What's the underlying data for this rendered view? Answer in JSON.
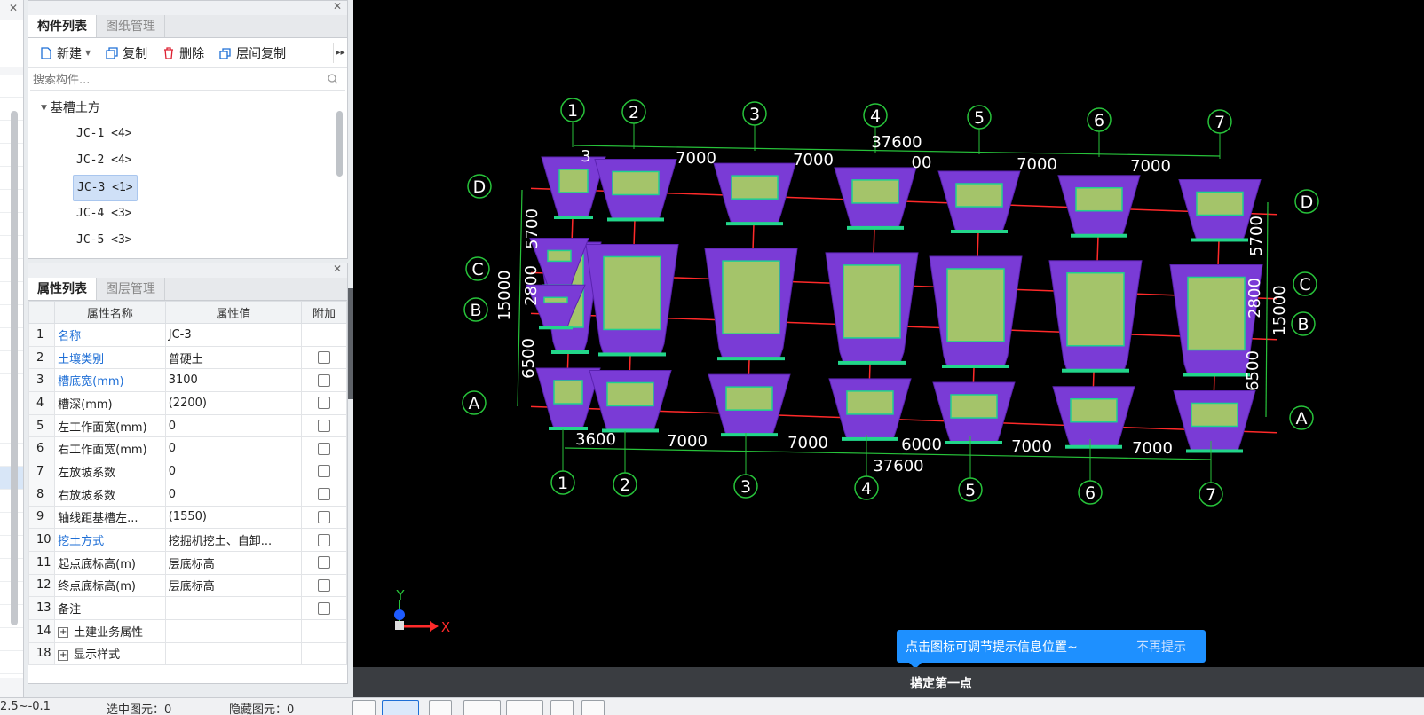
{
  "component_panel": {
    "tabs": [
      "构件列表",
      "图纸管理"
    ],
    "toolbar": {
      "new": "新建",
      "copy": "复制",
      "delete": "删除",
      "floor_copy": "层间复制"
    },
    "search_placeholder": "搜索构件...",
    "tree": {
      "root": "基槽土方",
      "items": [
        "JC-1 <4>",
        "JC-2 <4>",
        "JC-3 <1>",
        "JC-4 <3>",
        "JC-5 <3>"
      ],
      "selected_index": 2
    }
  },
  "property_panel": {
    "tabs": [
      "属性列表",
      "图层管理"
    ],
    "columns": [
      "属性名称",
      "属性值",
      "附加"
    ],
    "rows": [
      {
        "idx": "1",
        "name": "名称",
        "value": "JC-3",
        "blue": true,
        "checkbox": false
      },
      {
        "idx": "2",
        "name": "土壤类别",
        "value": "普硬土",
        "blue": true,
        "checkbox": true
      },
      {
        "idx": "3",
        "name": "槽底宽(mm)",
        "value": "3100",
        "blue": true,
        "checkbox": true
      },
      {
        "idx": "4",
        "name": "槽深(mm)",
        "value": "(2200)",
        "blue": false,
        "checkbox": true
      },
      {
        "idx": "5",
        "name": "左工作面宽(mm)",
        "value": "0",
        "blue": false,
        "checkbox": true
      },
      {
        "idx": "6",
        "name": "右工作面宽(mm)",
        "value": "0",
        "blue": false,
        "checkbox": true
      },
      {
        "idx": "7",
        "name": "左放坡系数",
        "value": "0",
        "blue": false,
        "checkbox": true
      },
      {
        "idx": "8",
        "name": "右放坡系数",
        "value": "0",
        "blue": false,
        "checkbox": true
      },
      {
        "idx": "9",
        "name": "轴线距基槽左...",
        "value": "(1550)",
        "blue": false,
        "checkbox": true
      },
      {
        "idx": "10",
        "name": "挖土方式",
        "value": "挖掘机挖土、自卸...",
        "blue": true,
        "checkbox": true
      },
      {
        "idx": "11",
        "name": "起点底标高(m)",
        "value": "层底标高",
        "blue": false,
        "checkbox": true
      },
      {
        "idx": "12",
        "name": "终点底标高(m)",
        "value": "层底标高",
        "blue": false,
        "checkbox": true
      },
      {
        "idx": "13",
        "name": "备注",
        "value": "",
        "blue": false,
        "checkbox": true
      },
      {
        "idx": "14",
        "name": "土建业务属性",
        "value": "",
        "blue": false,
        "checkbox": false,
        "expand": true
      },
      {
        "idx": "18",
        "name": "显示样式",
        "value": "",
        "blue": false,
        "checkbox": false,
        "expand": true
      }
    ]
  },
  "viewport": {
    "axis_numbers": [
      "1",
      "2",
      "3",
      "4",
      "5",
      "6",
      "7"
    ],
    "axis_letters": [
      "A",
      "B",
      "C",
      "D"
    ],
    "top_total": "37600",
    "bottom_total": "37600",
    "top_dims": [
      "3",
      "7000",
      "7000",
      "00",
      "7000",
      "7000"
    ],
    "bottom_dims": [
      "3600",
      "7000",
      "7000",
      "6000",
      "7000",
      "7000"
    ],
    "left_dims": [
      "5700",
      "2800",
      "6500"
    ],
    "left_total": "15000",
    "right_dims": [
      "5700",
      "2800",
      "6500"
    ],
    "right_total": "15000",
    "ucs_y": "Y",
    "ucs_x": "X",
    "tip_text": "点击图标可调节提示信息位置~",
    "tip_dismiss": "不再提示",
    "command_prompt": "指定第一点",
    "colors": {
      "pit_side": "#7a3bd6",
      "pit_bottom": "#a4c46a",
      "grid": "#27c23a",
      "beam": "#ff2a2a"
    }
  },
  "statusbar": {
    "coords": "2.5~-0.1",
    "selected": "选中图元：0",
    "hidden": "隐藏图元：0"
  }
}
